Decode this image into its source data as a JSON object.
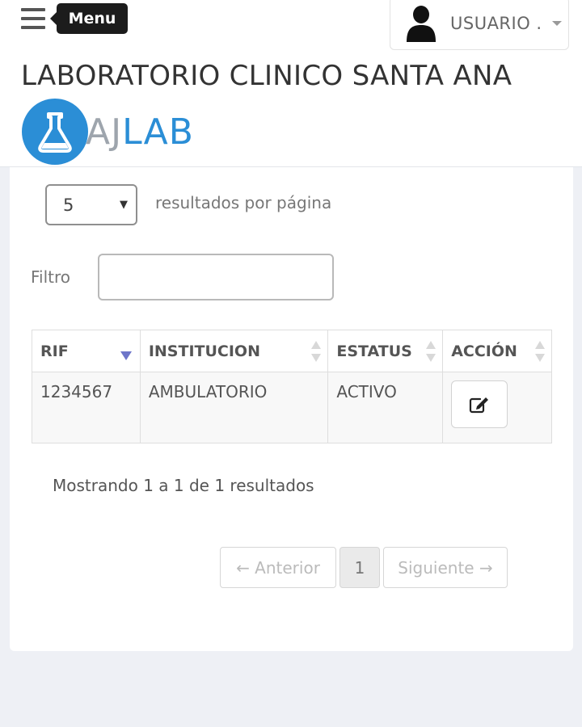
{
  "header": {
    "menu_tooltip": "Menu",
    "user_label": "USUARIO .",
    "lab_title": "LABORATORIO CLINICO SANTA ANA",
    "logo": {
      "aj": "AJ",
      "lab": "LAB"
    }
  },
  "controls": {
    "length_value": "5",
    "length_label": "resultados por página",
    "filter_label": "Filtro",
    "filter_value": ""
  },
  "table": {
    "columns": [
      "RIF",
      "INSTITUCION",
      "ESTATUS",
      "ACCIÓN"
    ],
    "rows": [
      {
        "rif": "1234567",
        "institucion": "AMBULATORIO",
        "estatus": "ACTIVO"
      }
    ]
  },
  "info": "Mostrando 1 a 1 de 1 resultados",
  "pagination": {
    "previous": "← Anterior",
    "current": "1",
    "next": "Siguiente →"
  },
  "colors": {
    "accent": "#2b8ed6",
    "sort_active": "#6d75c9",
    "tooltip_bg": "#1c1c1c"
  }
}
